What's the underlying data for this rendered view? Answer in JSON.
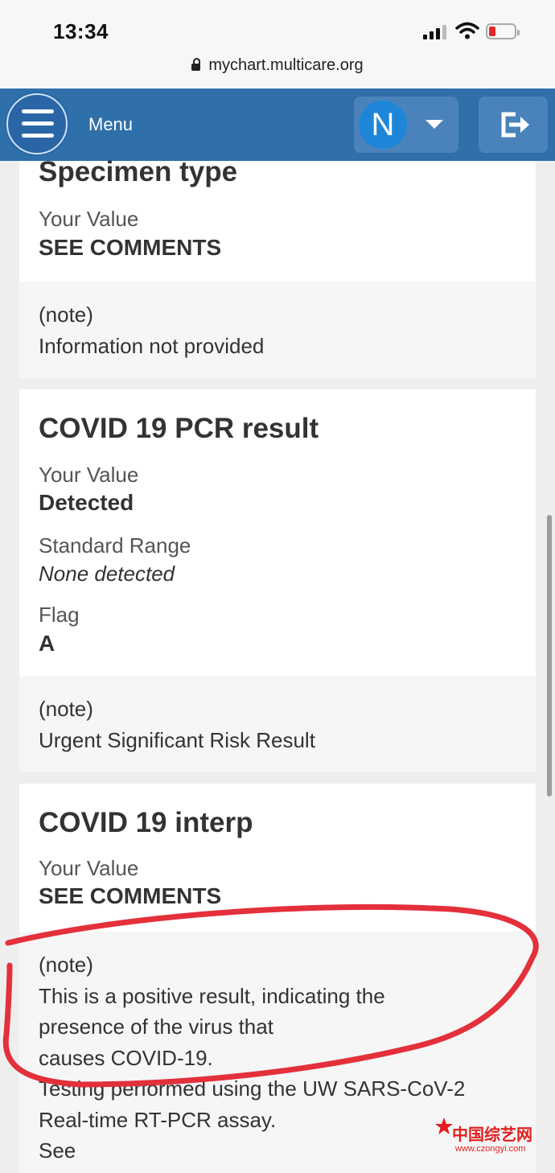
{
  "status_bar": {
    "time": "13:34",
    "url": "mychart.multicare.org"
  },
  "header": {
    "menu_label": "Menu",
    "user_initial": "N"
  },
  "results": {
    "specimen": {
      "title": "Specimen type",
      "value_label": "Your Value",
      "value": "SEE COMMENTS",
      "note_label": "(note)",
      "note_text": "Information not provided"
    },
    "pcr": {
      "title": "COVID 19 PCR result",
      "value_label": "Your Value",
      "value": "Detected",
      "range_label": "Standard Range",
      "range": "None detected",
      "flag_label": "Flag",
      "flag": "A",
      "note_label": "(note)",
      "note_text": "Urgent Significant Risk Result"
    },
    "interp": {
      "title": "COVID 19 interp",
      "value_label": "Your Value",
      "value": "SEE COMMENTS",
      "note_label": "(note)",
      "note_lines": [
        "This is a positive result, indicating the",
        "presence of the virus that",
        "causes COVID-19.",
        "Testing performed using the UW SARS-CoV-2",
        "Real-time RT-PCR assay.",
        "See"
      ]
    }
  },
  "watermark": {
    "title": "中国综艺网",
    "url": "www.czongyi.com"
  },
  "colors": {
    "header_blue": "#2f6faa",
    "annotation_red": "#e3303b"
  }
}
